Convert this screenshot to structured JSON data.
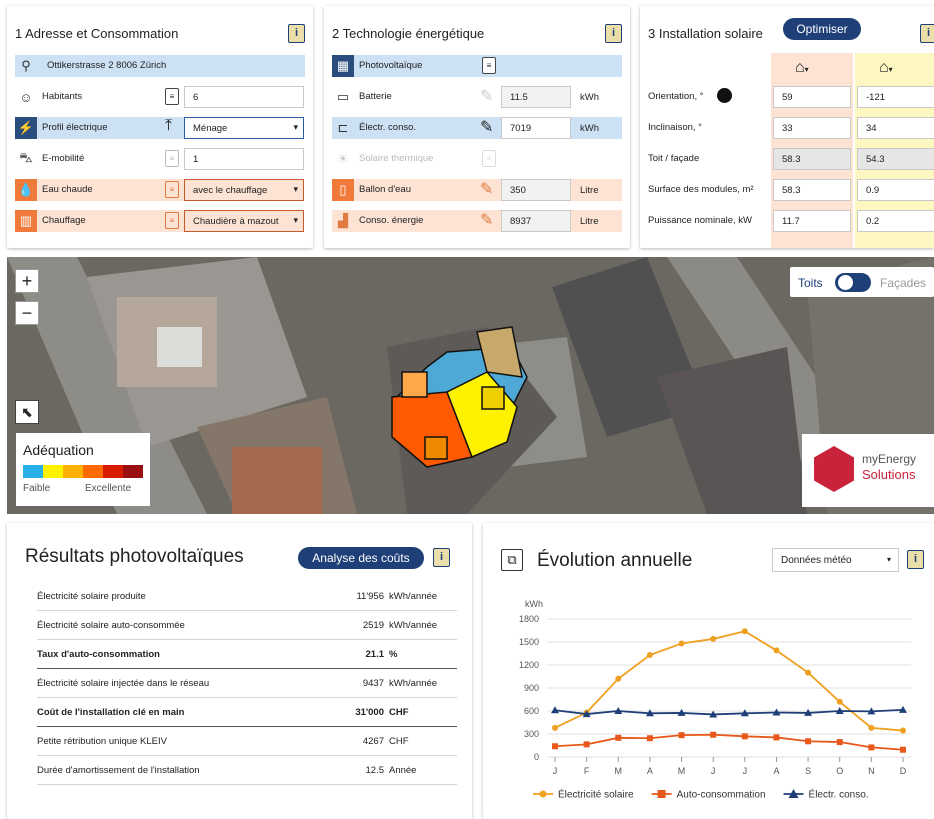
{
  "panel1": {
    "title": "1 Adresse et Consommation",
    "info": "i",
    "address": "Ottikerstrasse 2 8006 Zürich",
    "rows": [
      {
        "label": "Habitants",
        "value": "6"
      },
      {
        "label": "Profil électrique",
        "value": "Ménage"
      },
      {
        "label": "E-mobilité",
        "value": "1"
      },
      {
        "label": "Eau chaude",
        "value": "avec le chauffage"
      },
      {
        "label": "Chauffage",
        "value": "Chaudière à mazout"
      }
    ]
  },
  "panel2": {
    "title": "2 Technologie énergétique",
    "info": "i",
    "rows": [
      {
        "label": "Photovoltaïque",
        "value": "",
        "unit": ""
      },
      {
        "label": "Batterie",
        "value": "11.5",
        "unit": "kWh"
      },
      {
        "label": "Électr. conso.",
        "value": "7019",
        "unit": "kWh"
      },
      {
        "label": "Solaire thermique",
        "value": "",
        "unit": ""
      },
      {
        "label": "Ballon d'eau",
        "value": "350",
        "unit": "Litre"
      },
      {
        "label": "Conso. énergie",
        "value": "8937",
        "unit": "Litre"
      }
    ]
  },
  "panel3": {
    "title": "3 Installation solaire",
    "optimise": "Optimiser",
    "info": "i",
    "rows": [
      {
        "label": "Orientation, °",
        "a": "59",
        "b": "-121"
      },
      {
        "label": "Inclinaison, °",
        "a": "33",
        "b": "34"
      },
      {
        "label": "Toit / façade",
        "a": "58.3",
        "b": "54.3"
      },
      {
        "label": "Surface des modules, m²",
        "a": "58.3",
        "b": "0.9"
      },
      {
        "label": "Puissance nominale, kW",
        "a": "11.7",
        "b": "0.2"
      }
    ]
  },
  "map": {
    "zoom_in": "+",
    "zoom_out": "−",
    "toggle_left": "Toits",
    "toggle_right": "Façades",
    "legend_title": "Adéquation",
    "legend_low": "Faible",
    "legend_high": "Excellente",
    "legend_colors": [
      "#2ab0e8",
      "#fff200",
      "#ffb000",
      "#ff6a00",
      "#d81c00",
      "#9a1010"
    ],
    "brand1": "myEnergy",
    "brand2": "Solutions"
  },
  "results": {
    "title": "Résultats photovoltaïques",
    "button": "Analyse des coûts",
    "info": "i",
    "rows": [
      {
        "label": "Électricité solaire produite",
        "value": "11'956",
        "unit": "kWh/année",
        "bold": false
      },
      {
        "label": "Électricité solaire auto-consommée",
        "value": "2519",
        "unit": "kWh/année",
        "bold": false
      },
      {
        "label": "Taux d'auto-consommation",
        "value": "21.1",
        "unit": "%",
        "bold": true
      },
      {
        "label": "Électricité solaire injectée dans le réseau",
        "value": "9437",
        "unit": "kWh/année",
        "bold": false
      },
      {
        "label": "Coût de l'installation clé en main",
        "value": "31'000",
        "unit": "CHF",
        "bold": true
      },
      {
        "label": "Petite rétribution unique KLEIV",
        "value": "4267",
        "unit": "CHF",
        "bold": false
      },
      {
        "label": "Durée d'amortissement de l'installation",
        "value": "12.5",
        "unit": "Année",
        "bold": false
      }
    ]
  },
  "evolution": {
    "title": "Évolution annuelle",
    "dropdown": "Données météo",
    "info": "i"
  },
  "chart_data": {
    "type": "line",
    "ylabel": "kWh",
    "ylim": [
      0,
      1800
    ],
    "yticks": [
      0,
      300,
      600,
      900,
      1200,
      1500,
      1800
    ],
    "categories": [
      "J",
      "F",
      "M",
      "A",
      "M",
      "J",
      "J",
      "A",
      "S",
      "O",
      "N",
      "D"
    ],
    "series": [
      {
        "name": "Électricité solaire",
        "color": "#f0a020",
        "marker": "circle",
        "values": [
          380,
          580,
          1020,
          1330,
          1480,
          1540,
          1640,
          1390,
          1100,
          720,
          380,
          345
        ]
      },
      {
        "name": "Auto-consommation",
        "color": "#e8581a",
        "marker": "square",
        "values": [
          140,
          165,
          250,
          245,
          285,
          290,
          270,
          255,
          205,
          195,
          125,
          95
        ]
      },
      {
        "name": "Électr. conso.",
        "color": "#1f3f78",
        "marker": "triangle",
        "values": [
          610,
          560,
          600,
          570,
          575,
          555,
          570,
          580,
          575,
          600,
          595,
          615
        ]
      }
    ],
    "legend": "bottom"
  }
}
